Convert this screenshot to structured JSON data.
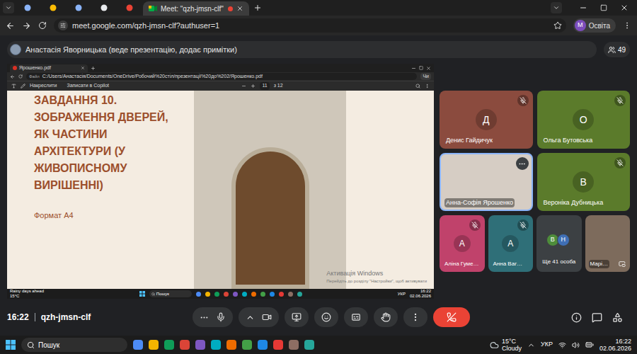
{
  "browser": {
    "tabs": [
      {
        "kind": "icon",
        "selected": false
      },
      {
        "kind": "icon",
        "selected": false
      },
      {
        "kind": "icon",
        "selected": false
      },
      {
        "kind": "icon",
        "selected": false
      },
      {
        "kind": "icon",
        "selected": false
      },
      {
        "kind": "text",
        "label": "Meet: \"qzh-jmsn-clf\"",
        "selected": true,
        "recording": true
      }
    ],
    "address": "meet.google.com/qzh-jmsn-clf?authuser=1",
    "profile": {
      "initial": "M",
      "label": "Освіта"
    }
  },
  "presentation_banner": {
    "text": "Анастасія Яворницька (веде презентацію, додає примітки)",
    "participants_count": "49"
  },
  "shared_screen": {
    "viewer_tab": "Ярошенко.pdf",
    "file_label": "Файл",
    "path": "C:/Users/Анастасія/Documents/OneDrive/Робочий%20стіл/презентації%20до%202/Ярошенко.pdf",
    "toolbar": {
      "draw": "Накреслити",
      "copilot": "Записати в Copilot",
      "page": "11",
      "page_total": "з 12",
      "chat": "Чи"
    },
    "slide": {
      "title_lines": [
        "ЗАВДАННЯ 10.",
        "ЗОБРАЖЕННЯ ДВЕРЕЙ,",
        "ЯК ЧАСТИНИ",
        "АРХІТЕКТУРИ (У",
        "ЖИВОПИСНОМУ",
        "ВИРІШЕННІ)"
      ],
      "format": "Формат А4"
    },
    "watermark": {
      "title": "Активація Windows",
      "subtitle": "Перейдіть до розділу \"Настройки\", щоб активувати"
    },
    "taskbar": {
      "weather": "Rainy days ahead",
      "temperature": "15°C",
      "search": "Пошук",
      "language": "УКР",
      "time": "16:22",
      "date": "02.06.2026"
    }
  },
  "participants": [
    {
      "name": "Денис Гайдичук",
      "kind": "avatar",
      "initial": "Д",
      "muted": true,
      "highlighted": false,
      "color": "#8b4b3e"
    },
    {
      "name": "Ольга Бутовська",
      "kind": "avatar",
      "initial": "О",
      "muted": true,
      "highlighted": false,
      "color": "#5b7b2b"
    },
    {
      "name": "Анна-Софія Ярошенко",
      "kind": "video",
      "muted": false,
      "highlighted": true,
      "color": "#d6cdc4"
    },
    {
      "name": "Вероніка Дубницька",
      "kind": "avatar",
      "initial": "В",
      "muted": true,
      "highlighted": false,
      "color": "#5b7b2b"
    },
    {
      "name": "Аліна Гуме…",
      "kind": "avatar",
      "initial": "А",
      "muted": true,
      "highlighted": false,
      "color": "#c0426b"
    },
    {
      "name": "Анна Ваг…",
      "kind": "avatar",
      "initial": "А",
      "muted": true,
      "highlighted": false,
      "color": "#2f6f78"
    },
    {
      "name": "Ще 41 особа",
      "kind": "more",
      "muted": false,
      "highlighted": false,
      "color": "#3c4043",
      "avatars": [
        {
          "initial": "В",
          "color": "#4e8d3b"
        },
        {
          "initial": "Н",
          "color": "#3f6fb5"
        }
      ]
    },
    {
      "name": "Марі…",
      "kind": "video",
      "muted": false,
      "highlighted": false,
      "color": "#7d6b5c"
    }
  ],
  "meeting_bar": {
    "time": "16:22",
    "code": "qzh-jmsn-clf",
    "mic_on": true,
    "camera_on": true
  },
  "taskbar": {
    "search": "Пошук",
    "temperature": "15°C",
    "weather": "Cloudy",
    "language": "УКР",
    "time": "16:22",
    "date": "02.06.2026"
  }
}
